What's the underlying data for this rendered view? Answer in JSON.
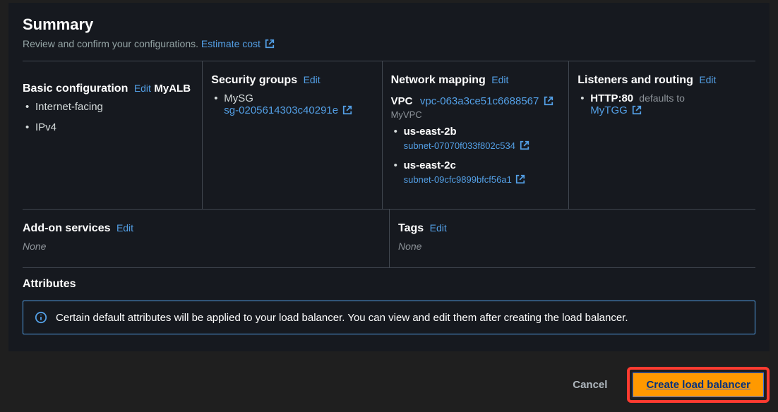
{
  "header": {
    "title": "Summary",
    "subtitle_prefix": "Review and confirm your configurations. ",
    "estimate_link": "Estimate cost"
  },
  "basic": {
    "title": "Basic configuration",
    "edit": "Edit",
    "name": "MyALB",
    "items": [
      "Internet-facing",
      "IPv4"
    ]
  },
  "security": {
    "title": "Security groups",
    "edit": "Edit",
    "items": [
      "MySG"
    ],
    "sg_link": "sg-0205614303c40291e"
  },
  "network": {
    "title": "Network mapping",
    "edit": "Edit",
    "vpc_label": "VPC",
    "vpc_id": "vpc-063a3ce51c6688567",
    "vpc_name": "MyVPC",
    "azs": [
      {
        "name": "us-east-2b",
        "subnet": "subnet-07070f033f802c534"
      },
      {
        "name": "us-east-2c",
        "subnet": "subnet-09cfc9899bfcf56a1"
      }
    ]
  },
  "listeners": {
    "title": "Listeners and routing",
    "edit": "Edit",
    "protocol": "HTTP:80",
    "defaults_to": "defaults to",
    "target_group": "MyTGG"
  },
  "addons": {
    "title": "Add-on services",
    "edit": "Edit",
    "value": "None"
  },
  "tags": {
    "title": "Tags",
    "edit": "Edit",
    "value": "None"
  },
  "attributes": {
    "title": "Attributes",
    "info": "Certain default attributes will be applied to your load balancer. You can view and edit them after creating the load balancer."
  },
  "footer": {
    "cancel": "Cancel",
    "create": "Create load balancer"
  }
}
